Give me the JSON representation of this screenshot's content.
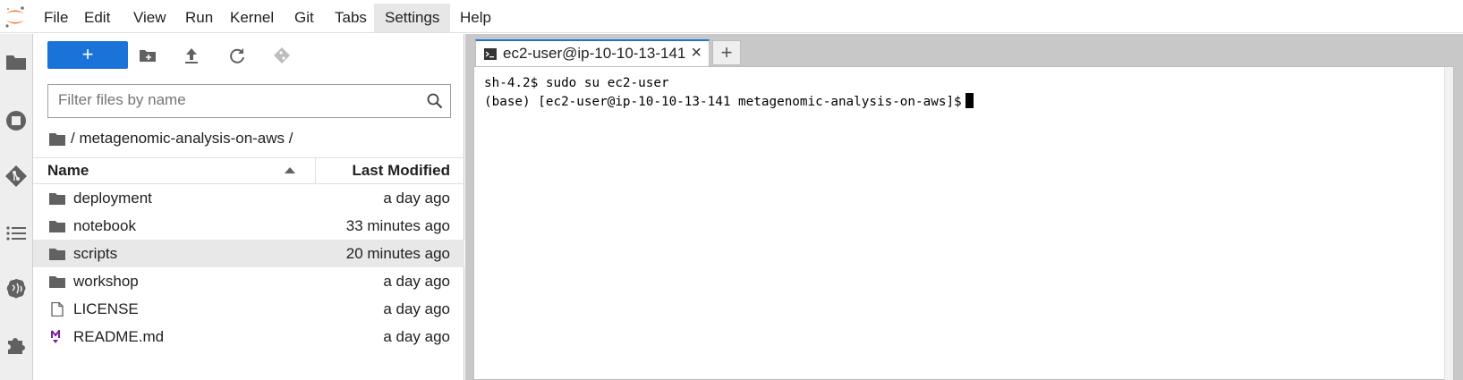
{
  "menubar": {
    "items": [
      "File",
      "Edit",
      "View",
      "Run",
      "Kernel",
      "Git",
      "Tabs",
      "Settings",
      "Help"
    ],
    "active": "Settings"
  },
  "sidebar": {
    "icons": [
      "folder-icon",
      "running-kernels-icon",
      "git-icon",
      "table-of-contents-icon",
      "property-inspector-icon",
      "extensions-icon"
    ]
  },
  "filebrowser": {
    "new_label": "+",
    "filter_placeholder": "Filter files by name",
    "breadcrumb": "/ metagenomic-analysis-on-aws /",
    "col_name": "Name",
    "col_modified": "Last Modified",
    "files": [
      {
        "name": "deployment",
        "modified": "a day ago",
        "type": "folder"
      },
      {
        "name": "notebook",
        "modified": "33 minutes ago",
        "type": "folder"
      },
      {
        "name": "scripts",
        "modified": "20 minutes ago",
        "type": "folder",
        "selected": true
      },
      {
        "name": "workshop",
        "modified": "a day ago",
        "type": "folder"
      },
      {
        "name": "LICENSE",
        "modified": "a day ago",
        "type": "file"
      },
      {
        "name": "README.md",
        "modified": "a day ago",
        "type": "markdown"
      }
    ]
  },
  "terminal": {
    "tab_label": "ec2-user@ip-10-10-13-141",
    "tab_close": "×",
    "add_tab": "+",
    "lines": [
      "sh-4.2$ sudo su ec2-user",
      "(base) [ec2-user@ip-10-10-13-141 metagenomic-analysis-on-aws]$"
    ]
  },
  "colors": {
    "accent": "#1976d2",
    "new_button": "#1a73d9",
    "markdown_icon": "#7b1fa2",
    "jupyter_orange": "#f37726"
  }
}
